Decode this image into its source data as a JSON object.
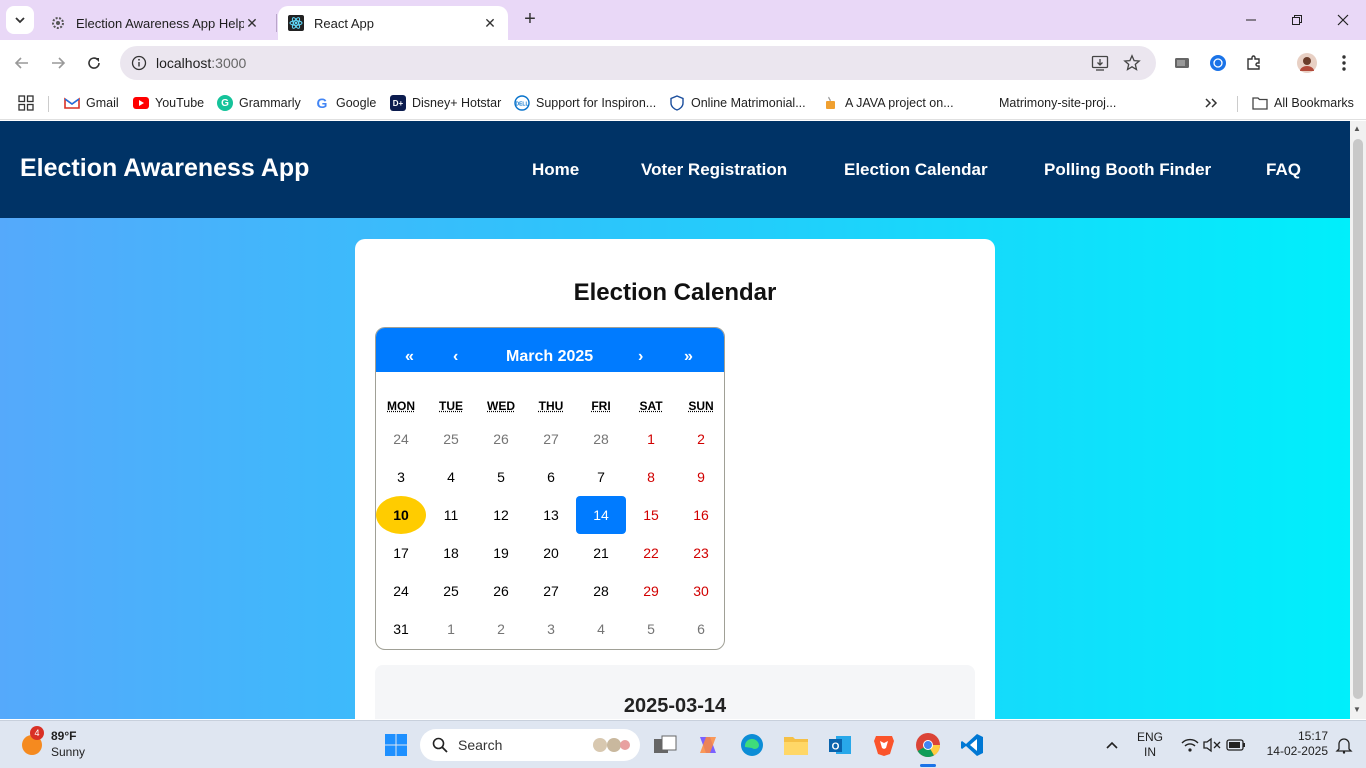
{
  "browser": {
    "tabs": [
      {
        "title": "Election Awareness App Help",
        "active": false
      },
      {
        "title": "React App",
        "active": true
      }
    ],
    "url_host": "localhost",
    "url_port": ":3000",
    "bookmarks": [
      {
        "label": "Gmail",
        "icon": "gmail-icon"
      },
      {
        "label": "YouTube",
        "icon": "youtube-icon"
      },
      {
        "label": "Grammarly",
        "icon": "grammarly-icon"
      },
      {
        "label": "Google",
        "icon": "google-icon"
      },
      {
        "label": "Disney+ Hotstar",
        "icon": "hotstar-icon"
      },
      {
        "label": "Support for Inspiron...",
        "icon": "dell-icon"
      },
      {
        "label": "Online Matrimonial...",
        "icon": "shield-icon"
      },
      {
        "label": "A JAVA project on...",
        "icon": "java-icon"
      },
      {
        "label": "Matrimony-site-proj...",
        "icon": ""
      }
    ],
    "all_bookmarks": "All Bookmarks"
  },
  "app": {
    "title": "Election Awareness App",
    "nav": [
      "Home",
      "Voter Registration",
      "Election Calendar",
      "Polling Booth Finder",
      "FAQ"
    ],
    "page_heading": "Election Calendar",
    "calendar": {
      "prev2": "«",
      "prev": "‹",
      "label": "March 2025",
      "next": "›",
      "next2": "»",
      "weekdays": [
        "MON",
        "TUE",
        "WED",
        "THU",
        "FRI",
        "SAT",
        "SUN"
      ],
      "weeks": [
        [
          "24",
          "25",
          "26",
          "27",
          "28",
          "1",
          "2"
        ],
        [
          "3",
          "4",
          "5",
          "6",
          "7",
          "8",
          "9"
        ],
        [
          "10",
          "11",
          "12",
          "13",
          "14",
          "15",
          "16"
        ],
        [
          "17",
          "18",
          "19",
          "20",
          "21",
          "22",
          "23"
        ],
        [
          "24",
          "25",
          "26",
          "27",
          "28",
          "29",
          "30"
        ],
        [
          "31",
          "1",
          "2",
          "3",
          "4",
          "5",
          "6"
        ]
      ],
      "today": "10",
      "selected": "14"
    },
    "selected_date": "2025-03-14"
  },
  "taskbar": {
    "weather_temp": "89°F",
    "weather_cond": "Sunny",
    "weather_badge": "4",
    "search_label": "Search",
    "lang1": "ENG",
    "lang2": "IN",
    "time": "15:17",
    "date": "14-02-2025"
  },
  "colors": {
    "header": "#003366",
    "accent": "#007bff",
    "today": "#ffcc00",
    "weekend": "#d10000"
  }
}
